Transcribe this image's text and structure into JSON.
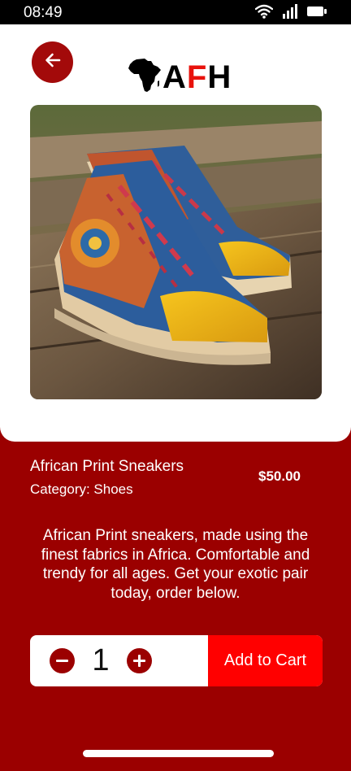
{
  "status_bar": {
    "time": "08:49",
    "icons": [
      "wifi-icon",
      "signal-icon",
      "battery-icon"
    ]
  },
  "header": {
    "back_icon": "arrow-left-icon",
    "logo": {
      "emblem": "africa-map-icon",
      "letters": [
        "A",
        "F",
        "H"
      ]
    }
  },
  "product": {
    "image": "african-print-sneakers-photo",
    "name": "African Print Sneakers",
    "category": "Category: Shoes",
    "price": "$50.00",
    "description": "African Print sneakers, made using the finest fabrics in Africa. Comfortable and trendy for all ages. Get your exotic pair today, order below."
  },
  "cart": {
    "quantity": "1",
    "minus_icon": "minus-icon",
    "plus_icon": "plus-icon",
    "add_label": "Add to Cart"
  },
  "colors": {
    "background": "#9b0000",
    "accent": "#ff0000",
    "logo_accent": "#e8120c",
    "white": "#ffffff"
  }
}
